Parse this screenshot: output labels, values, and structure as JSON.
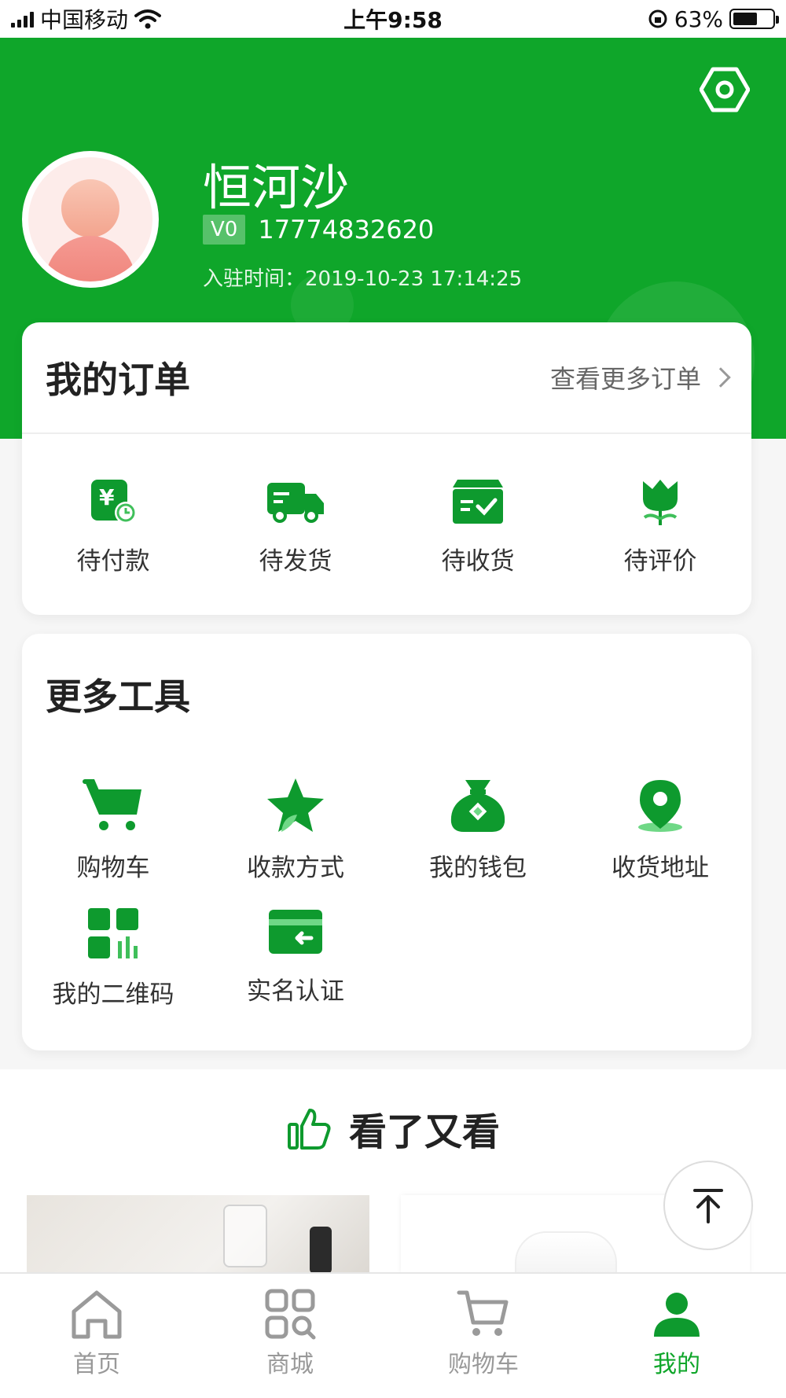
{
  "status_bar": {
    "carrier": "中国移动",
    "time": "上午9:58",
    "battery": "63%"
  },
  "profile": {
    "name": "恒河沙",
    "level": "V0",
    "phone": "17774832620",
    "join_label": "入驻时间：",
    "join_time": "2019-10-23 17:14:25"
  },
  "orders": {
    "title": "我的订单",
    "more_label": "查看更多订单",
    "items": [
      {
        "label": "待付款",
        "icon": "pending-payment-icon"
      },
      {
        "label": "待发货",
        "icon": "truck-icon"
      },
      {
        "label": "待收货",
        "icon": "receive-box-icon"
      },
      {
        "label": "待评价",
        "icon": "tulip-review-icon"
      }
    ]
  },
  "tools": {
    "title": "更多工具",
    "items": [
      {
        "label": "购物车",
        "icon": "cart-icon"
      },
      {
        "label": "收款方式",
        "icon": "star-icon"
      },
      {
        "label": "我的钱包",
        "icon": "money-bag-icon"
      },
      {
        "label": "收货地址",
        "icon": "location-pin-icon"
      },
      {
        "label": "我的二维码",
        "icon": "qr-code-icon"
      },
      {
        "label": "实名认证",
        "icon": "id-card-icon"
      }
    ]
  },
  "recommend": {
    "title": "看了又看"
  },
  "bottom_nav": {
    "items": [
      {
        "label": "首页",
        "icon": "home-icon"
      },
      {
        "label": "商城",
        "icon": "mall-grid-icon"
      },
      {
        "label": "购物车",
        "icon": "cart-outline-icon"
      },
      {
        "label": "我的",
        "icon": "user-icon"
      }
    ],
    "active_index": 3
  },
  "colors": {
    "brand": "#0fa62a",
    "icon_green": "#0e9a2e",
    "inactive": "#999999"
  }
}
